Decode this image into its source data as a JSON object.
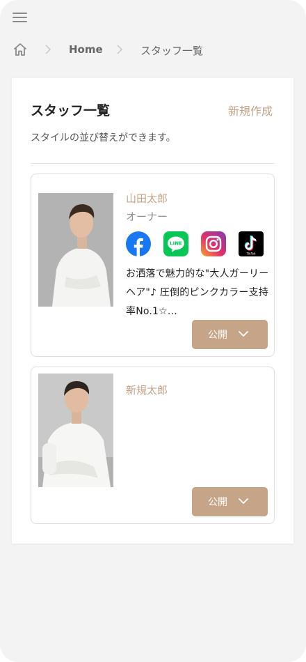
{
  "breadcrumb": {
    "home_label": "Home",
    "current": "スタッフ一覧"
  },
  "page": {
    "title": "スタッフ一覧",
    "new_label": "新規作成",
    "description": "スタイルの並び替えができます。"
  },
  "staff": [
    {
      "name": "山田太郎",
      "role": "オーナー",
      "sns": [
        "facebook-icon",
        "line-icon",
        "instagram-icon",
        "tiktok-icon"
      ],
      "description": "お洒落で魅力的な\"大人ガーリーヘア\"♪ 圧倒的ピンクカラー支持率No.1☆...",
      "status": "公開"
    },
    {
      "name": "新規太郎",
      "role": "",
      "sns": [],
      "description": "",
      "status": "公開"
    }
  ],
  "colors": {
    "accent": "#c6a487",
    "background": "#f3f3f3",
    "panel": "#ffffff",
    "facebook": "#1877f2",
    "line": "#06c755"
  }
}
